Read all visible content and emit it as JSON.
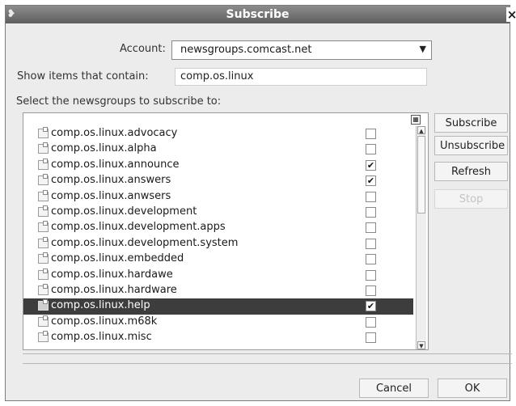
{
  "window": {
    "title": "Subscribe",
    "menu_glyph": "❥",
    "close_glyph": "×"
  },
  "account": {
    "label": "Account:",
    "value": "newsgroups.comcast.net"
  },
  "filter": {
    "label": "Show items that contain:",
    "value": "comp.os.linux"
  },
  "list": {
    "label": "Select the newsgroups to subscribe to:",
    "items": [
      {
        "name": "comp.os.linux.advocacy",
        "subscribed": false,
        "selected": false
      },
      {
        "name": "comp.os.linux.alpha",
        "subscribed": false,
        "selected": false
      },
      {
        "name": "comp.os.linux.announce",
        "subscribed": true,
        "selected": false
      },
      {
        "name": "comp.os.linux.answers",
        "subscribed": true,
        "selected": false
      },
      {
        "name": "comp.os.linux.anwsers",
        "subscribed": false,
        "selected": false
      },
      {
        "name": "comp.os.linux.development",
        "subscribed": false,
        "selected": false
      },
      {
        "name": "comp.os.linux.development.apps",
        "subscribed": false,
        "selected": false
      },
      {
        "name": "comp.os.linux.development.system",
        "subscribed": false,
        "selected": false
      },
      {
        "name": "comp.os.linux.embedded",
        "subscribed": false,
        "selected": false
      },
      {
        "name": "comp.os.linux.hardawe",
        "subscribed": false,
        "selected": false
      },
      {
        "name": "comp.os.linux.hardware",
        "subscribed": false,
        "selected": false
      },
      {
        "name": "comp.os.linux.help",
        "subscribed": true,
        "selected": true
      },
      {
        "name": "comp.os.linux.m68k",
        "subscribed": false,
        "selected": false
      },
      {
        "name": "comp.os.linux.misc",
        "subscribed": false,
        "selected": false
      }
    ]
  },
  "buttons": {
    "subscribe": "Subscribe",
    "unsubscribe": "Unsubscribe",
    "refresh": "Refresh",
    "stop": "Stop",
    "cancel": "Cancel",
    "ok": "OK"
  },
  "colors": {
    "selection": "#3d3d3d",
    "titlebar": "#6f6f6f",
    "dialog_bg": "#ececec"
  }
}
